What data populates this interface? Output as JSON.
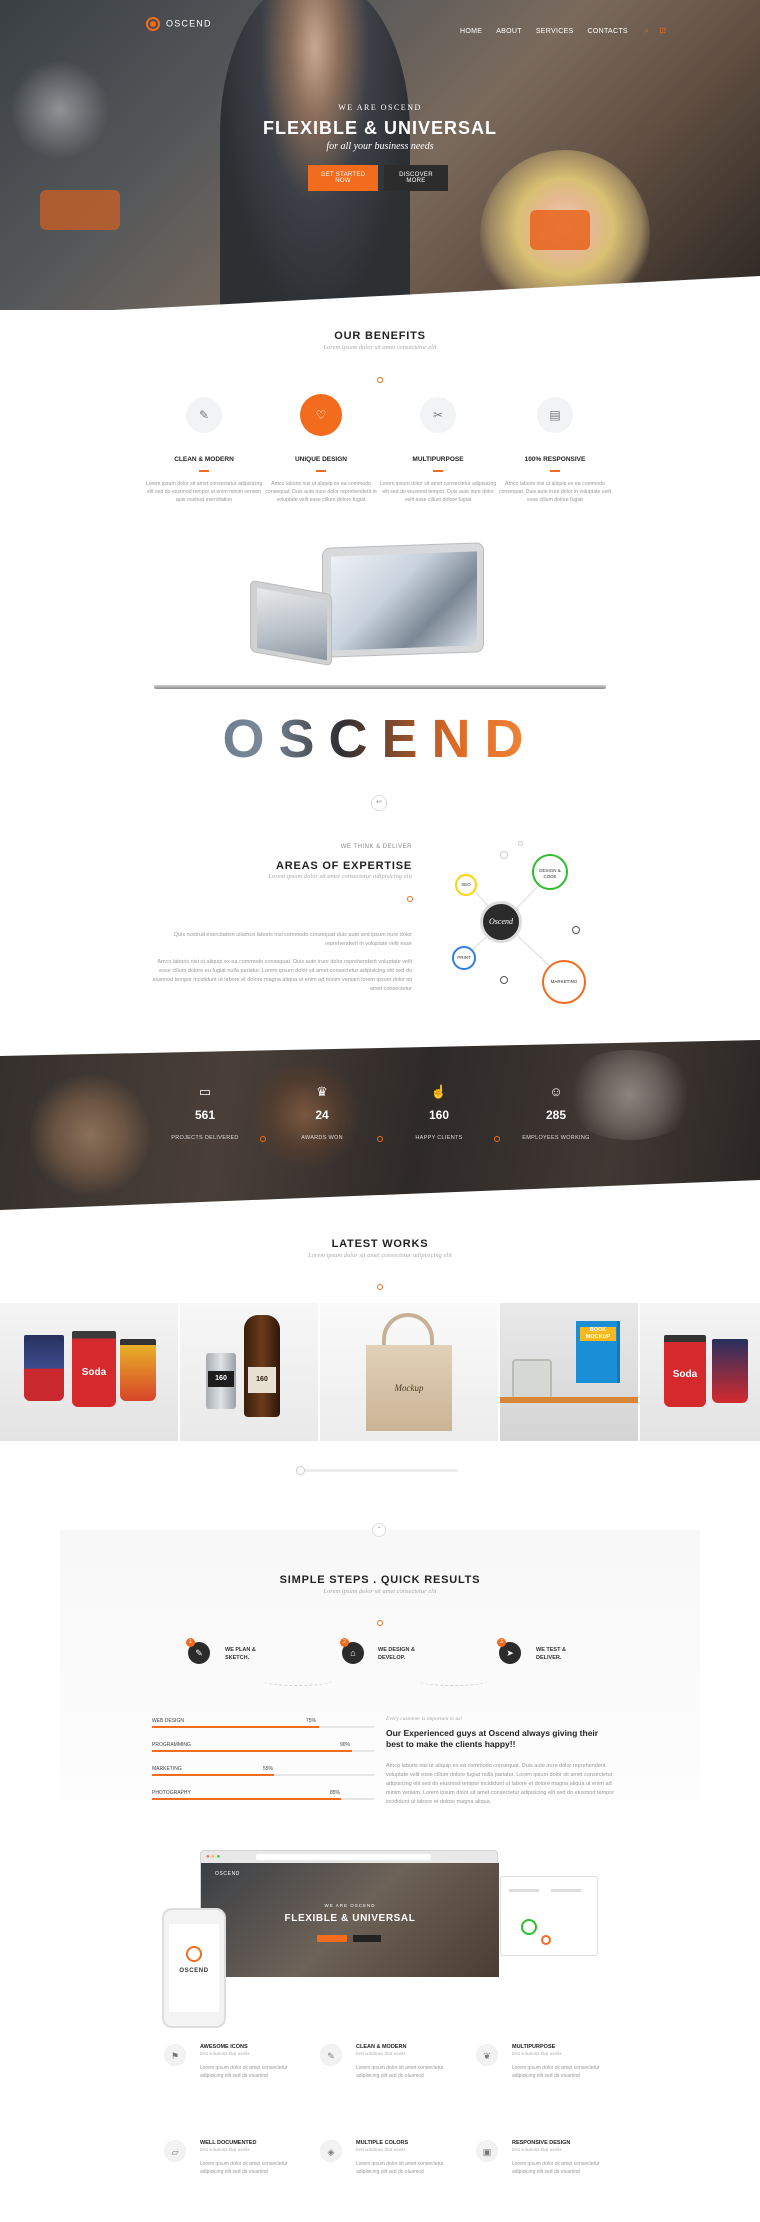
{
  "brand": {
    "name": "OSCEND",
    "accent": "#f36b1c"
  },
  "nav": {
    "items": [
      "HOME",
      "ABOUT",
      "SERVICES",
      "CONTACTS"
    ]
  },
  "hero": {
    "kicker": "WE ARE OSCEND",
    "title": "FLEXIBLE & UNIVERSAL",
    "subtitle": "for all your business needs",
    "primary_button": "GET STARTED NOW",
    "secondary_button": "DISCOVER MORE"
  },
  "benefits": {
    "title": "OUR BENEFITS",
    "subtitle": "Lorem ipsum dolor sit amet consectetur elit",
    "items": [
      {
        "icon": "pencil-icon",
        "glyph": "✎",
        "title": "CLEAN & MODERN",
        "text": "Lorem ipsum dolor sit amet consectetur adipisicing elit sed do eiusmod tempor ut enim minim veniam quis nostrud exercitation"
      },
      {
        "icon": "heart-icon",
        "glyph": "♡",
        "title": "UNIQUE DESIGN",
        "text": "Amco laboris nisi ut aliquip ex ea commodo consequat. Duis aute irure dolor reprehenderit in voluptate velit esse cillum dolore fugiat"
      },
      {
        "icon": "tools-icon",
        "glyph": "✂",
        "title": "MULTIPURPOSE",
        "text": "Lorem ipsum dolor sit amet consectetur adipisicing elit sed do eiusmod tempor. Duis aute irure dolor velit esse cillum dolore fugiat"
      },
      {
        "icon": "layout-icon",
        "glyph": "▤",
        "title": "100% RESPONSIVE",
        "text": "Amco laboris nisi ut aliquip ex ea commodo consequat. Duis aute irure dolor in voluptate velit esse cillum dolore fugiat"
      }
    ]
  },
  "wordmark": "OSCEND",
  "expertise": {
    "kicker": "WE THINK & DELIVER",
    "title": "AREAS OF EXPERTISE",
    "subtitle": "Lorem ipsum dolor sit amet consectetur adipisicing elit",
    "para1": "Quis nostrud exercitation ullamco laboris nisi commodo consequat duis aute sed ipsum irure dolor reprehenderit in voluptate velit esse",
    "para2": "Amco laboris nisi ut aliquip ex ea commodo consequat. Duis aute irure dolor reprehenderit voluptate velit esse cillum dolore eu fugiat nulla pariatur. Lorem ipsum dolor sit amet consectetur adipisicing elit sed do eiusmod tempor incididunt ut labore et dolore magna aliqua ut enim ad minim veniam lorem ipsum dolor sit amet consectetur",
    "center": "Oscend",
    "bubbles": [
      "SEO",
      "DESIGN & CODE",
      "PRINT",
      "MARKETING"
    ]
  },
  "stats": [
    {
      "icon": "wallet-icon",
      "glyph": "▭",
      "num": "561",
      "label": "PROJECTS DELIVERED"
    },
    {
      "icon": "trophy-icon",
      "glyph": "♛",
      "num": "24",
      "label": "AWARDS WON"
    },
    {
      "icon": "thumbs-up-icon",
      "glyph": "☝",
      "num": "160",
      "label": "HAPPY CLIENTS"
    },
    {
      "icon": "users-icon",
      "glyph": "☺",
      "num": "285",
      "label": "EMPLOYEES WORKING"
    }
  ],
  "works": {
    "title": "LATEST WORKS",
    "subtitle": "Lorem ipsum dolor sit amet consectetur adipisicing elit",
    "cup_label": "Soda",
    "beer_label": "160",
    "bag_label": "Mockup",
    "book_label": "BOOK MOCKUP"
  },
  "steps": {
    "title": "SIMPLE STEPS . QUICK RESULTS",
    "subtitle": "Lorem ipsum dolor sit amet consectetur elit",
    "items": [
      {
        "n": "1",
        "glyph": "✎",
        "label": "WE PLAN & SKETCH."
      },
      {
        "n": "2",
        "glyph": "⌂",
        "label": "WE DESIGN & DEVELOP."
      },
      {
        "n": "3",
        "glyph": "➤",
        "label": "WE TEST & DELIVER."
      }
    ],
    "skills": [
      {
        "label": "WEB DESIGN",
        "pct": "75%",
        "v": 0.75
      },
      {
        "label": "PROGRAMMING",
        "pct": "90%",
        "v": 0.9
      },
      {
        "label": "MARKETING",
        "pct": "55%",
        "v": 0.55
      },
      {
        "label": "PHOTOGRAPHY",
        "pct": "85%",
        "v": 0.85
      }
    ],
    "quote_kicker": "Every customer is important to us!",
    "quote": "Our Experienced guys at Oscend always giving their best to make the clients happy!!",
    "quote_text": "Amco laboris nisi ut aliquip ex ea commodo consequat. Duis aute irure dolor reprehenderit voluptate velit esse cillum dolore fugiat nulla pariatur. Lorem ipsum dolor sit amet consectetur adipisicing elit sed do eiusmod tempor incididunt ut labore et dolore magna aliqua ut enim ad minim veniam. Lorem ipsum dolor sit amet consectetur adipisicing elit sed do eiusmod tempor incididunt ut labore et dolore magna aliqua."
  },
  "devices": {
    "title": "FLEXIBLE & UNIVERSAL",
    "kicker": "WE ARE OSCEND"
  },
  "features": [
    {
      "icon": "flag-icon",
      "glyph": "⚑",
      "title": "AWESOME ICONS",
      "sub": "best solutions that works",
      "text": "Lorem ipsum dolor sit amet consectetur adipisicing elit sed do eiusmod"
    },
    {
      "icon": "pencil-icon",
      "glyph": "✎",
      "title": "CLEAN & MODERN",
      "sub": "best solutions that works",
      "text": "Lorem ipsum dolor sit amet consectetur adipisicing elit sed do eiusmod"
    },
    {
      "icon": "leaf-icon",
      "glyph": "❦",
      "title": "MULTIPURPOSE",
      "sub": "best solutions that works",
      "text": "Lorem ipsum dolor sit amet consectetur adipisicing elit sed do eiusmod"
    },
    {
      "icon": "folder-icon",
      "glyph": "▱",
      "title": "WELL DOCUMENTED",
      "sub": "best solutions that works",
      "text": "Lorem ipsum dolor sit amet consectetur adipisicing elit sed do eiusmod"
    },
    {
      "icon": "layers-icon",
      "glyph": "◈",
      "title": "MULTIPLE COLORS",
      "sub": "best solutions that works",
      "text": "Lorem ipsum dolor sit amet consectetur adipisicing elit sed do eiusmod"
    },
    {
      "icon": "monitor-icon",
      "glyph": "▣",
      "title": "RESPONSIVE DESIGN",
      "sub": "best solutions that works",
      "text": "Lorem ipsum dolor sit amet consectetur adipisicing elit sed do eiusmod"
    }
  ]
}
